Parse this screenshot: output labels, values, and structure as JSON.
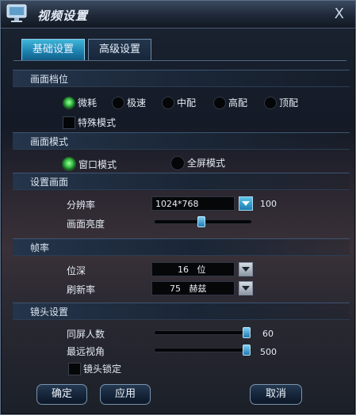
{
  "window": {
    "title": "视频设置",
    "close_glyph": "X"
  },
  "tabs": [
    {
      "label": "基础设置",
      "active": true
    },
    {
      "label": "高级设置",
      "active": false
    }
  ],
  "sections": {
    "quality": "画面档位",
    "display_mode": "画面模式",
    "screen": "设置画面",
    "framerate": "帧率",
    "camera": "镜头设置"
  },
  "quality_options": [
    "微耗",
    "极速",
    "中配",
    "高配",
    "顶配"
  ],
  "quality_selected": "微耗",
  "special_mode_label": "特殊模式",
  "special_mode_checked": false,
  "display_modes": [
    "窗口模式",
    "全屏模式"
  ],
  "display_mode_selected": "窗口模式",
  "resolution": {
    "label": "分辨率",
    "value": "1024*768",
    "extra_value": "100"
  },
  "brightness": {
    "label": "画面亮度",
    "level": 0.5
  },
  "bit_depth": {
    "label": "位深",
    "value": "16   位"
  },
  "refresh": {
    "label": "刷新率",
    "value": "75   赫兹"
  },
  "screen_players": {
    "label": "同屏人数",
    "value": "60",
    "level": 1.0
  },
  "view_distance": {
    "label": "最远视角",
    "value": "500",
    "level": 1.0
  },
  "lock_camera": {
    "label": "镜头锁定",
    "checked": false
  },
  "buttons": {
    "ok": "确定",
    "apply": "应用",
    "cancel": "取消"
  },
  "colors": {
    "accent": "#2fa8d6",
    "radio_on": "#3bc24a"
  }
}
